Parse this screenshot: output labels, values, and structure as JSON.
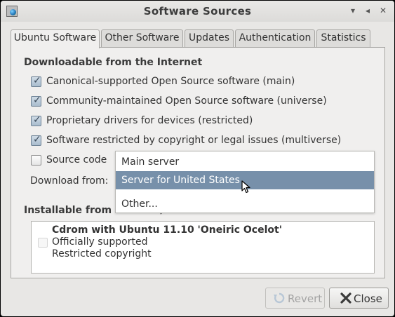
{
  "window": {
    "title": "Software Sources"
  },
  "titlebar_buttons": [
    "▾",
    "◂",
    "✕"
  ],
  "tabs": [
    {
      "label": "Ubuntu Software",
      "active": true
    },
    {
      "label": "Other Software",
      "active": false
    },
    {
      "label": "Updates",
      "active": false
    },
    {
      "label": "Authentication",
      "active": false
    },
    {
      "label": "Statistics",
      "active": false
    }
  ],
  "downloadable": {
    "title": "Downloadable from the Internet",
    "options": [
      {
        "label": "Canonical-supported Open Source software (main)",
        "checked": true
      },
      {
        "label": "Community-maintained Open Source software (universe)",
        "checked": true
      },
      {
        "label": "Proprietary drivers for devices (restricted)",
        "checked": true
      },
      {
        "label": "Software restricted by copyright or legal issues (multiverse)",
        "checked": true
      },
      {
        "label": "Source code",
        "checked": false
      }
    ],
    "download_from_label": "Download from:"
  },
  "dropdown": {
    "items": [
      {
        "label": "Main server",
        "selected": false
      },
      {
        "label": "Server for United States",
        "selected": true
      },
      {
        "label": "Other...",
        "selected": false
      }
    ]
  },
  "installable": {
    "title": "Installable from CD-ROM/DVD",
    "cdrom": {
      "name": "Cdrom with Ubuntu 11.10 'Oneiric Ocelot'",
      "line2": "Officially supported",
      "line3": "Restricted copyright"
    }
  },
  "buttons": {
    "revert": "Revert",
    "close": "Close"
  }
}
